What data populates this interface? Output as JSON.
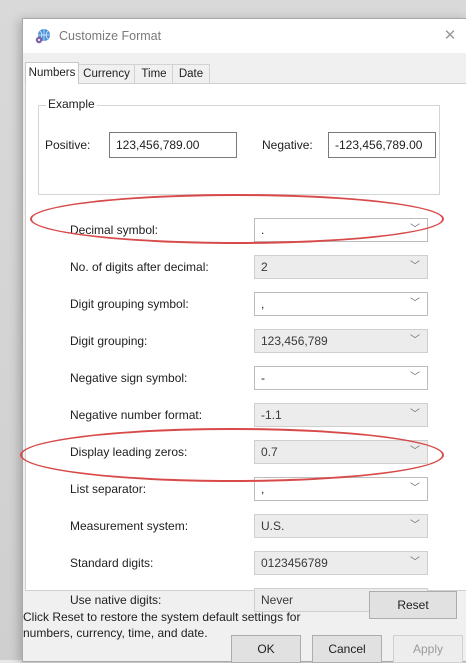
{
  "dialog": {
    "title": "Customize Format",
    "close_glyph": "✕"
  },
  "tabs": [
    "Numbers",
    "Currency",
    "Time",
    "Date"
  ],
  "example": {
    "caption": "Example",
    "positive_label": "Positive:",
    "positive_value": "123,456,789.00",
    "negative_label": "Negative:",
    "negative_value": "-123,456,789.00"
  },
  "settings": [
    {
      "label": "Decimal symbol:",
      "value": ".",
      "enabled": true
    },
    {
      "label": "No. of digits after decimal:",
      "value": "2",
      "enabled": false
    },
    {
      "label": "Digit grouping symbol:",
      "value": ",",
      "enabled": true
    },
    {
      "label": "Digit grouping:",
      "value": "123,456,789",
      "enabled": false
    },
    {
      "label": "Negative sign symbol:",
      "value": "-",
      "enabled": true
    },
    {
      "label": "Negative number format:",
      "value": "-1.1",
      "enabled": false
    },
    {
      "label": "Display leading zeros:",
      "value": "0.7",
      "enabled": false
    },
    {
      "label": "List separator:",
      "value": ",",
      "enabled": true
    },
    {
      "label": "Measurement system:",
      "value": "U.S.",
      "enabled": false
    },
    {
      "label": "Standard digits:",
      "value": "0123456789",
      "enabled": false
    },
    {
      "label": "Use native digits:",
      "value": "Never",
      "enabled": false
    }
  ],
  "footer": {
    "reset_note": "Click Reset to restore the system default settings for numbers, currency, time, and date.",
    "reset_label": "Reset",
    "ok_label": "OK",
    "cancel_label": "Cancel",
    "apply_label": "Apply"
  },
  "icons": {
    "app": "globe-settings-icon",
    "dropdown": "chevron-down-icon",
    "close": "close-icon"
  },
  "colors": {
    "highlight": "#d84a4a",
    "dialog_bg": "#f0f0f0"
  }
}
